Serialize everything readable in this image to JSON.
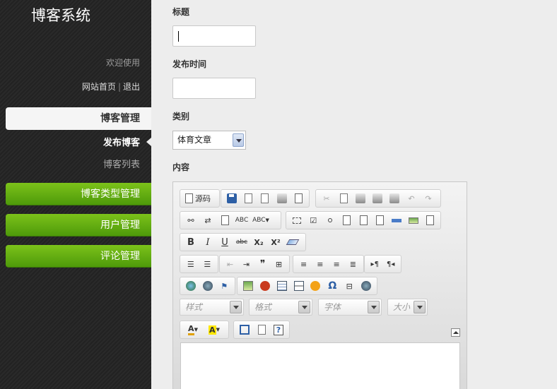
{
  "app": {
    "title": "博客系统"
  },
  "header": {
    "welcome": "欢迎使用",
    "home_link": "网站首页",
    "separator": "|",
    "logout_link": "退出"
  },
  "sidebar": {
    "active_section": "博客管理",
    "sub_items": [
      "发布博客",
      "博客列表"
    ],
    "sections": [
      "博客类型管理",
      "用户管理",
      "评论管理"
    ]
  },
  "form": {
    "title_label": "标题",
    "title_value": "",
    "date_label": "发布时间",
    "date_value": "",
    "category_label": "类别",
    "category_selected": "体育文章",
    "content_label": "内容"
  },
  "editor": {
    "source_label": "源码",
    "style_combo": "样式",
    "format_combo": "格式",
    "font_combo": "字体",
    "size_combo": "大小",
    "toolbar_icons": {
      "row1": [
        "source-icon",
        "save-icon",
        "new-page-icon",
        "preview-icon",
        "print-icon",
        "templates-icon",
        "cut-icon",
        "copy-icon",
        "paste-icon",
        "paste-text-icon",
        "paste-word-icon",
        "undo-icon",
        "redo-icon"
      ],
      "row2": [
        "find-icon",
        "replace-icon",
        "select-all-icon",
        "spellcheck-icon",
        "spellcheck-menu-icon",
        "form-icon",
        "checkbox-icon",
        "radio-icon",
        "textfield-icon",
        "textarea-icon",
        "select-icon",
        "button-icon",
        "image-button-icon",
        "hidden-field-icon"
      ],
      "row3": [
        "bold-icon",
        "italic-icon",
        "underline-icon",
        "strike-icon",
        "subscript-icon",
        "superscript-icon",
        "remove-format-icon"
      ],
      "row4": [
        "numbered-list-icon",
        "bulleted-list-icon",
        "outdent-icon",
        "indent-icon",
        "blockquote-icon",
        "div-icon",
        "align-left-icon",
        "align-center-icon",
        "align-right-icon",
        "justify-icon",
        "ltr-icon",
        "rtl-icon"
      ],
      "row5": [
        "link-icon",
        "unlink-icon",
        "anchor-icon",
        "image-icon",
        "flash-icon",
        "table-icon",
        "horizontal-rule-icon",
        "smiley-icon",
        "special-char-icon",
        "page-break-icon",
        "iframe-icon"
      ],
      "row7": [
        "text-color-icon",
        "bg-color-icon",
        "maximize-icon",
        "show-blocks-icon",
        "about-icon"
      ]
    },
    "glyphs": {
      "strike": "abc",
      "abc": "ABC",
      "bold": "B",
      "italic": "I",
      "underline": "U",
      "sub": "X₂",
      "sup": "X²",
      "quote": "❞",
      "omega": "Ω",
      "help": "?",
      "ltr": "▸¶",
      "rtl": "¶◂",
      "undo": "↶",
      "redo": "↷",
      "text_color": "A",
      "bg_color": "A"
    }
  }
}
